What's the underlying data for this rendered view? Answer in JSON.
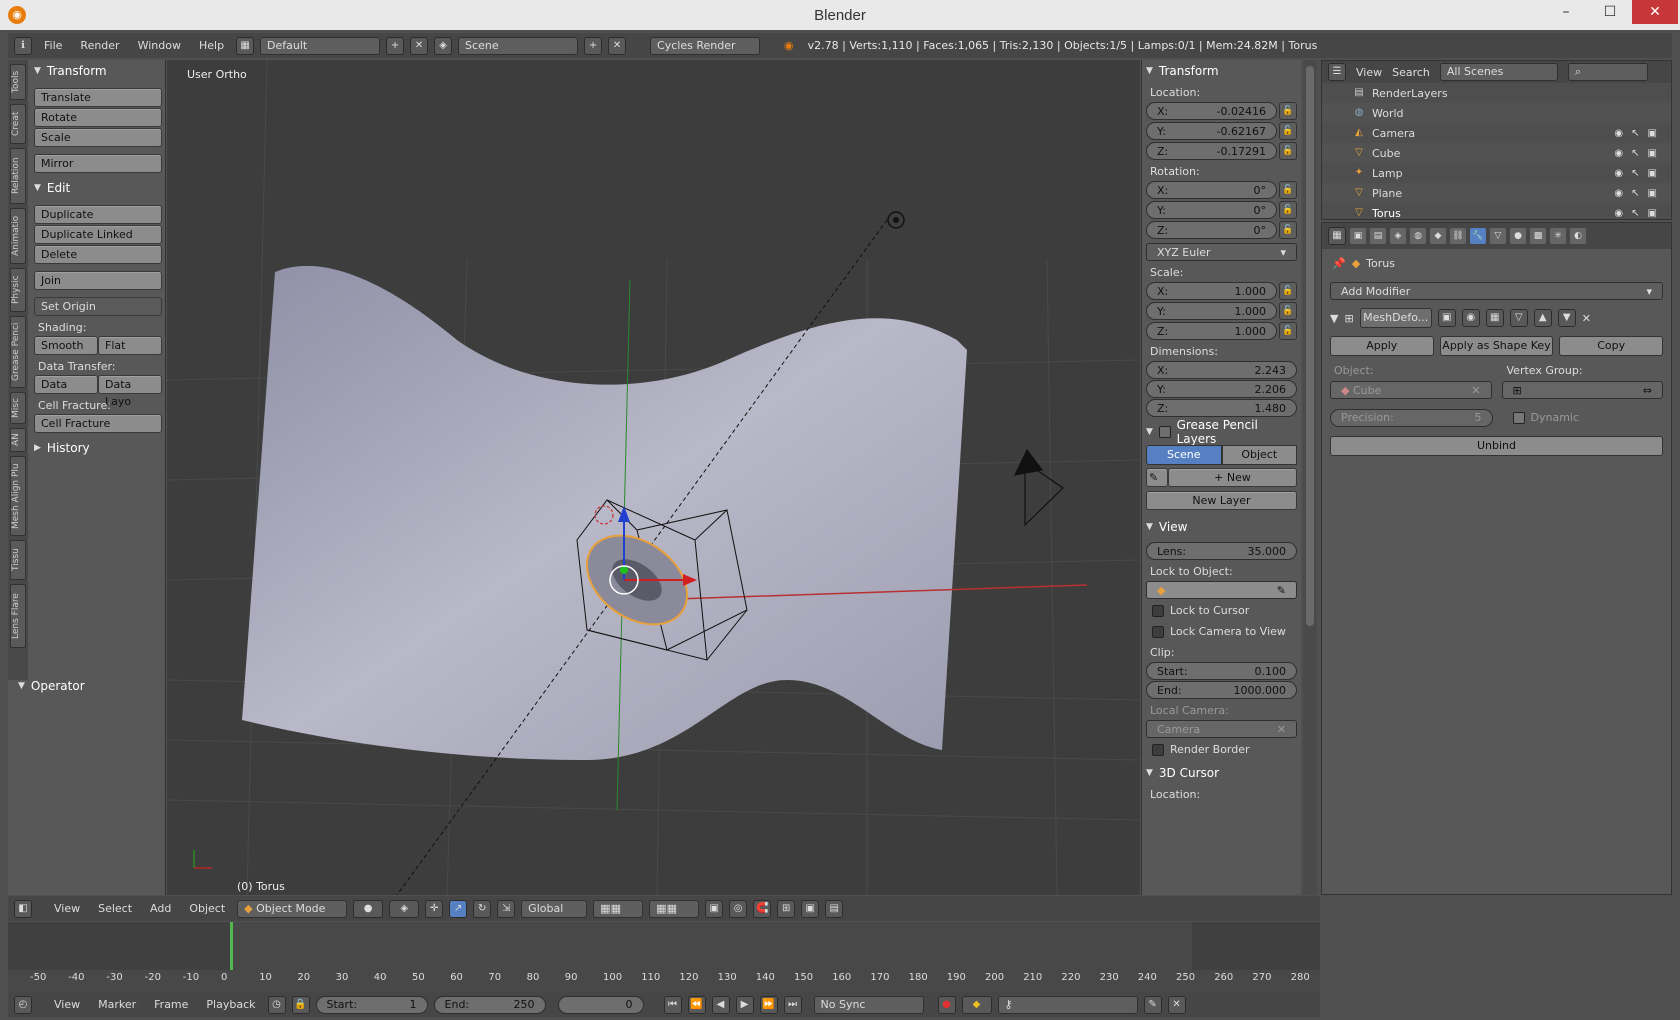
{
  "window": {
    "title": "Blender",
    "logo": "blender-logo-icon",
    "min": "–",
    "max": "☐",
    "close": "✕"
  },
  "infobar": {
    "menus": [
      "File",
      "Render",
      "Window",
      "Help"
    ],
    "layout": "Default",
    "scene": "Scene",
    "engine": "Cycles Render",
    "stats": "v2.78 | Verts:1,110 | Faces:1,065 | Tris:2,130 | Objects:1/5 | Lamps:0/1 | Mem:24.82M | Torus"
  },
  "toolshelf": {
    "tabs": [
      "Tools",
      "Creat",
      "Relation",
      "Animatio",
      "Physic",
      "Grease Penci",
      "Misc",
      "AN",
      "Mesh Align Plu",
      "Tissu",
      "Lens Flare"
    ],
    "transform": {
      "header": "Transform",
      "buttons": [
        "Translate",
        "Rotate",
        "Scale",
        "Mirror"
      ]
    },
    "edit": {
      "header": "Edit",
      "buttons": [
        "Duplicate",
        "Duplicate Linked",
        "Delete",
        "Join"
      ],
      "set_origin": "Set Origin",
      "shading_label": "Shading:",
      "smooth": "Smooth",
      "flat": "Flat",
      "data_transfer_label": "Data Transfer:",
      "data": "Data",
      "data_layo": "Data Layo",
      "cell_fracture_label": "Cell Fracture:",
      "cell_fracture": "Cell Fracture"
    },
    "history": "History",
    "operator": "Operator"
  },
  "viewport": {
    "view_label": "User Ortho",
    "object_label": "(0) Torus"
  },
  "npanel": {
    "transform": "Transform",
    "location_label": "Location:",
    "location": {
      "x": "-0.02416",
      "y": "-0.62167",
      "z": "-0.17291"
    },
    "rotation_label": "Rotation:",
    "rotation": {
      "x": "0°",
      "y": "0°",
      "z": "0°"
    },
    "rotation_mode": "XYZ Euler",
    "scale_label": "Scale:",
    "scale": {
      "x": "1.000",
      "y": "1.000",
      "z": "1.000"
    },
    "dimensions_label": "Dimensions:",
    "dimensions": {
      "x": "2.243",
      "y": "2.206",
      "z": "1.480"
    },
    "grease_pencil": "Grease Pencil Layers",
    "gp_scene": "Scene",
    "gp_object": "Object",
    "gp_new": "New",
    "gp_new_layer": "New Layer",
    "view": "View",
    "lens_label": "Lens:",
    "lens": "35.000",
    "lock_to_object": "Lock to Object:",
    "lock_to_cursor": "Lock to Cursor",
    "lock_camera": "Lock Camera to View",
    "clip_label": "Clip:",
    "clip_start_label": "Start:",
    "clip_start": "0.100",
    "clip_end_label": "End:",
    "clip_end": "1000.000",
    "local_camera": "Local Camera:",
    "camera": "Camera",
    "render_border": "Render Border",
    "cursor": "3D Cursor",
    "cursor_location": "Location:",
    "x": "X:",
    "y": "Y:",
    "z": "Z:"
  },
  "outliner": {
    "view": "View",
    "search": "Search",
    "scenes": "All Scenes",
    "items": [
      "RenderLayers",
      "World",
      "Camera",
      "Cube",
      "Lamp",
      "Plane",
      "Torus"
    ]
  },
  "properties": {
    "object": "Torus",
    "add_modifier": "Add Modifier",
    "modifier_name": "MeshDefo...",
    "apply": "Apply",
    "apply_shape": "Apply as Shape Key",
    "copy": "Copy",
    "object_label": "Object:",
    "object_value": "Cube",
    "vertex_group": "Vertex Group:",
    "precision_label": "Precision:",
    "precision": "5",
    "dynamic": "Dynamic",
    "unbind": "Unbind"
  },
  "vpheader": {
    "menus": [
      "View",
      "Select",
      "Add",
      "Object"
    ],
    "mode": "Object Mode",
    "orientation": "Global"
  },
  "timeline": {
    "ticks": [
      "-50",
      "-40",
      "-30",
      "-20",
      "-10",
      "0",
      "10",
      "20",
      "30",
      "40",
      "50",
      "60",
      "70",
      "80",
      "90",
      "100",
      "110",
      "120",
      "130",
      "140",
      "150",
      "160",
      "170",
      "180",
      "190",
      "200",
      "210",
      "220",
      "230",
      "240",
      "250",
      "260",
      "270",
      "280"
    ],
    "menus": [
      "View",
      "Marker",
      "Frame",
      "Playback"
    ],
    "start_label": "Start:",
    "start": "1",
    "end_label": "End:",
    "end": "250",
    "current": "0",
    "sync": "No Sync"
  }
}
